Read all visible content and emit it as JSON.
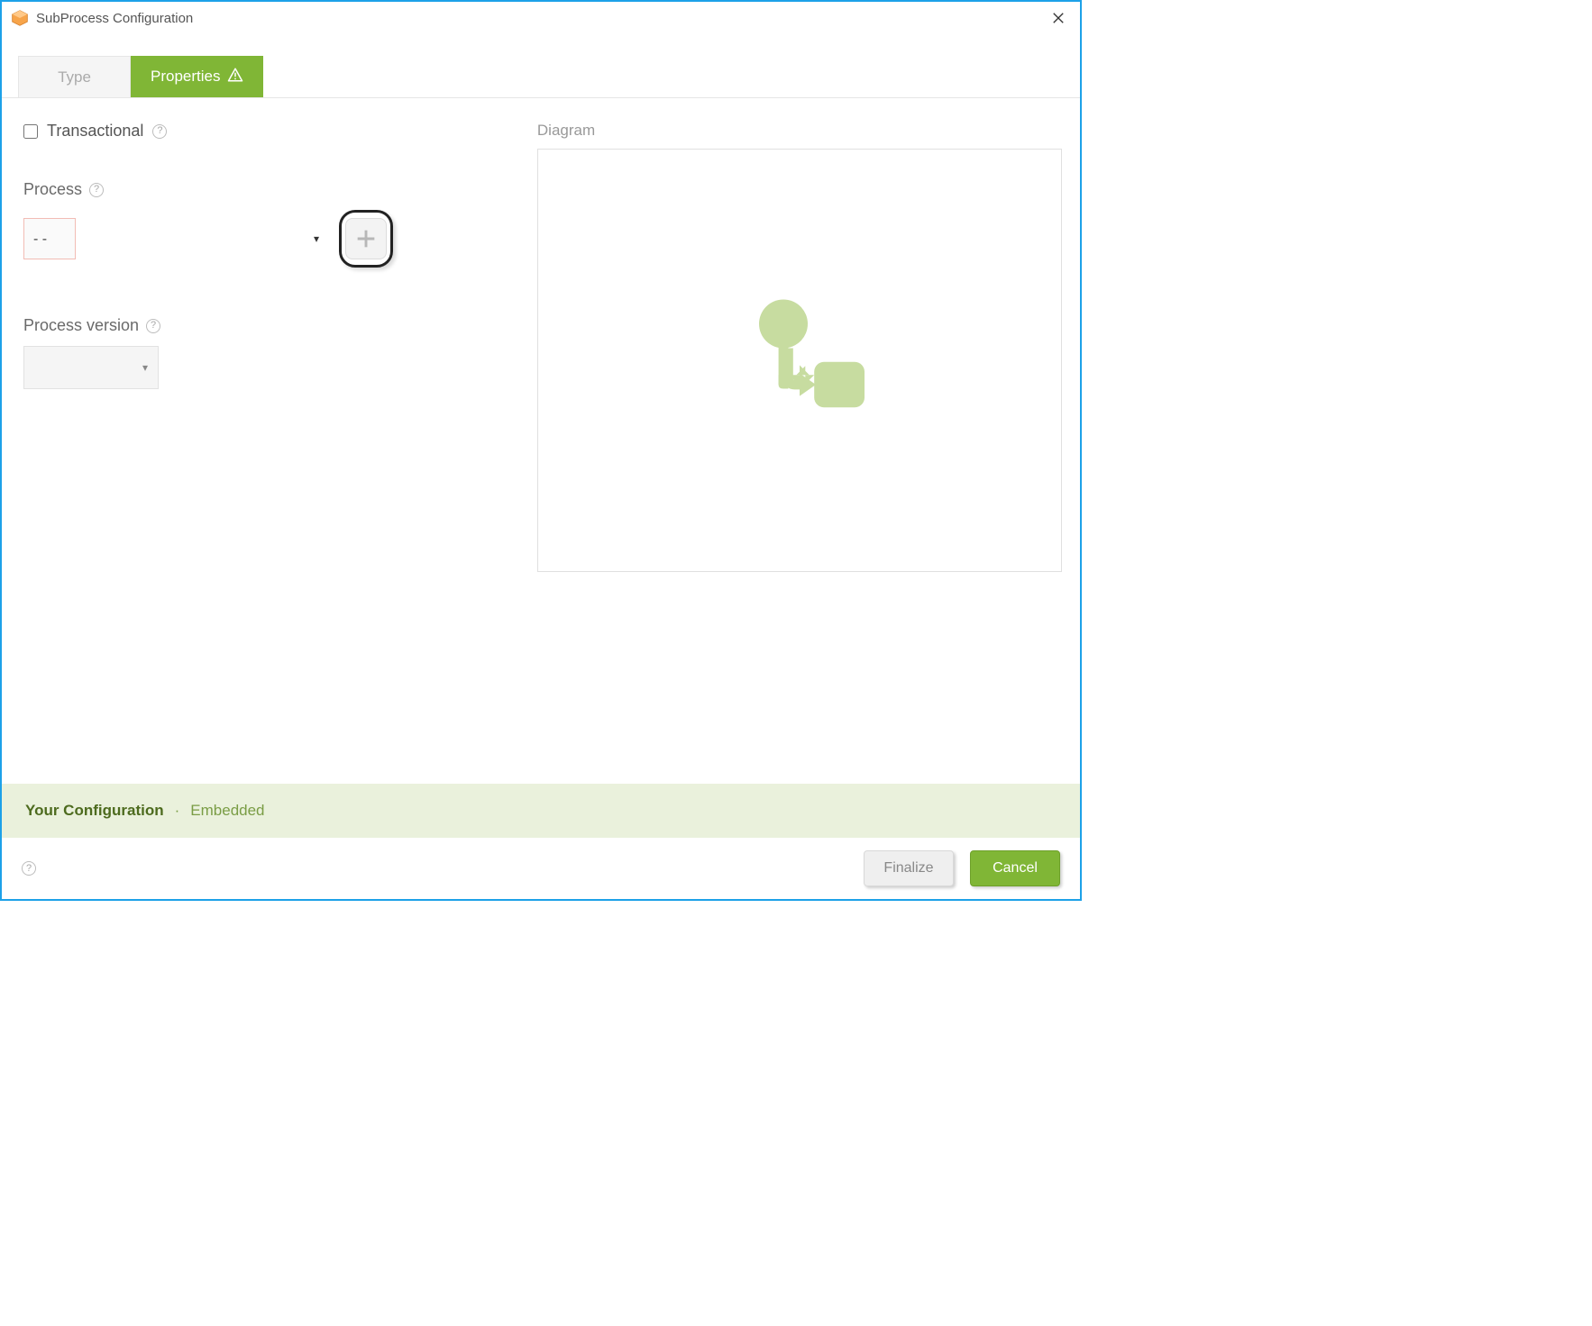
{
  "window": {
    "title": "SubProcess Configuration"
  },
  "tabs": {
    "type_label": "Type",
    "properties_label": "Properties"
  },
  "form": {
    "transactional_label": "Transactional",
    "process_label": "Process",
    "process_selected": "- -",
    "process_version_label": "Process version",
    "process_version_selected": ""
  },
  "diagram": {
    "label": "Diagram"
  },
  "summary": {
    "title": "Your Configuration",
    "value": "Embedded"
  },
  "footer": {
    "finalize_label": "Finalize",
    "cancel_label": "Cancel"
  }
}
